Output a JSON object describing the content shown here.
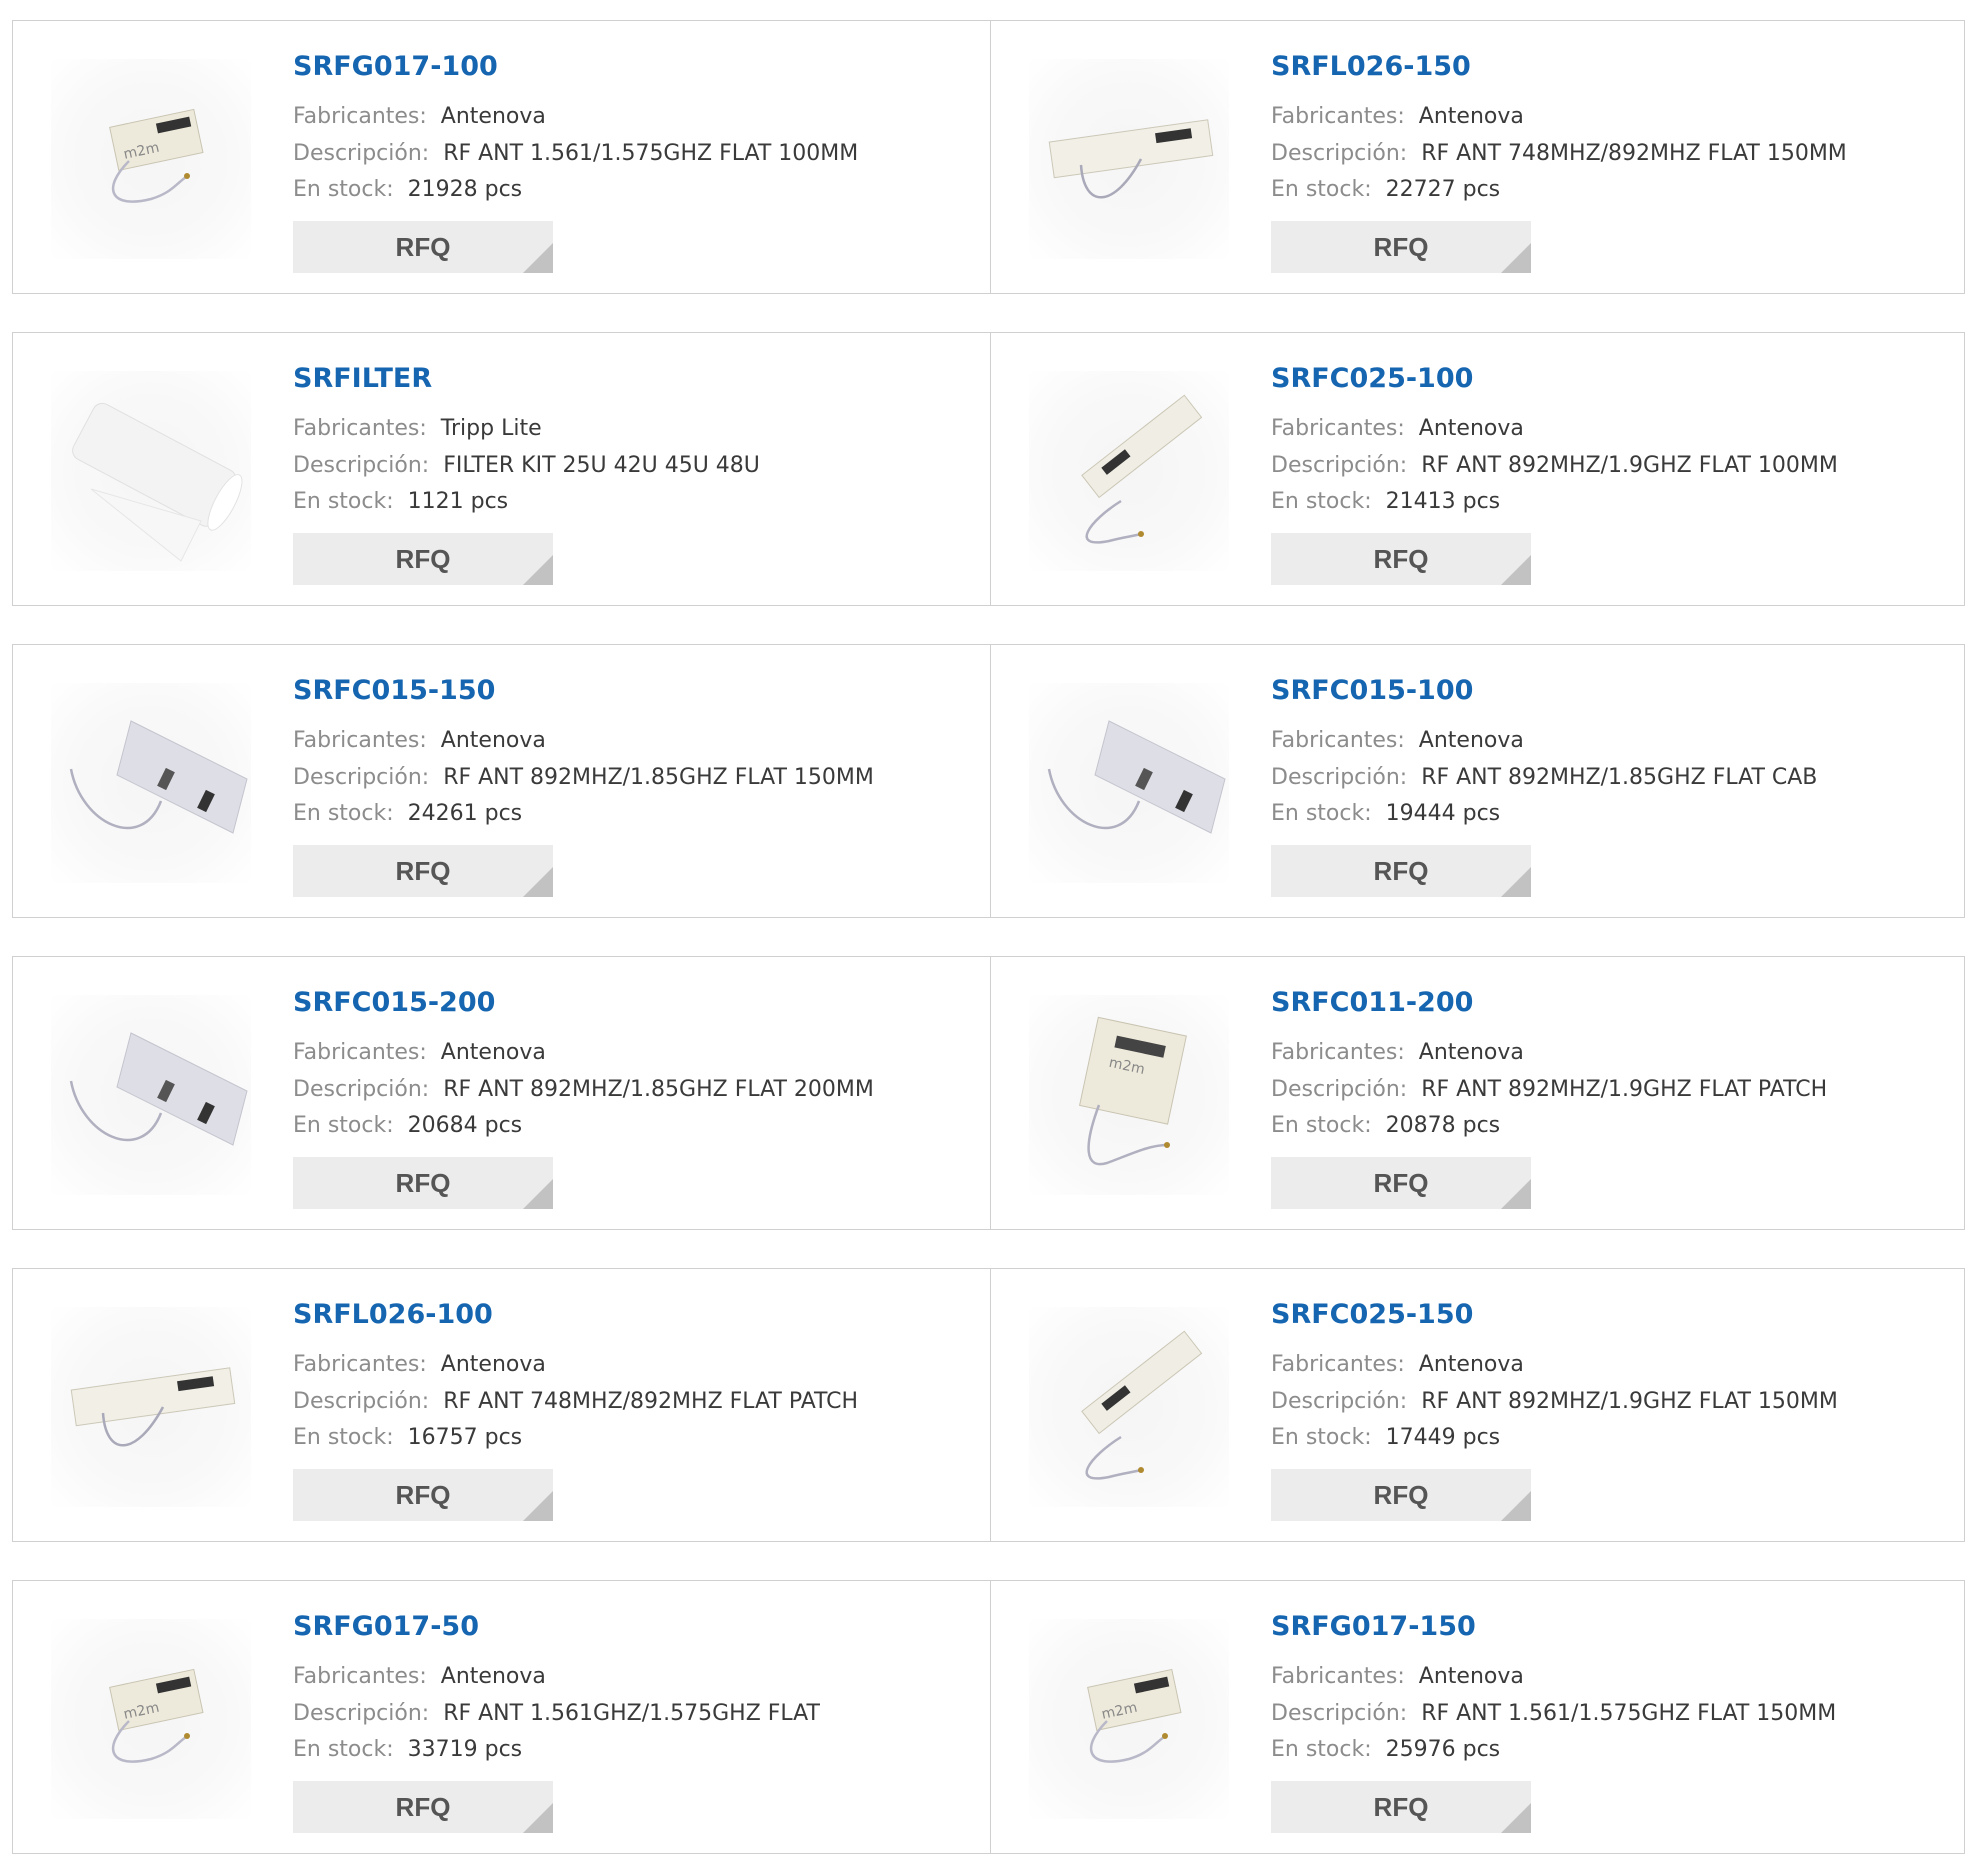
{
  "labels": {
    "manufacturer": "Fabricantes:",
    "description": "Descripción:",
    "stock": "En stock:",
    "rfq": "RFQ"
  },
  "products": [
    {
      "part": "SRFG017-100",
      "manufacturer": "Antenova",
      "description": "RF ANT 1.561/1.575GHZ FLAT 100MM",
      "stock": "21928 pcs",
      "image": "antenna-m2m-small"
    },
    {
      "part": "SRFL026-150",
      "manufacturer": "Antenova",
      "description": "RF ANT 748MHZ/892MHZ FLAT 150MM",
      "stock": "22727 pcs",
      "image": "antenna-long-flat"
    },
    {
      "part": "SRFILTER",
      "manufacturer": "Tripp Lite",
      "description": "FILTER KIT 25U 42U 45U 48U",
      "stock": "1121 pcs",
      "image": "filter-roll"
    },
    {
      "part": "SRFC025-100",
      "manufacturer": "Antenova",
      "description": "RF ANT 892MHZ/1.9GHZ FLAT 100MM",
      "stock": "21413 pcs",
      "image": "antenna-diagonal"
    },
    {
      "part": "SRFC015-150",
      "manufacturer": "Antenova",
      "description": "RF ANT 892MHZ/1.85GHZ FLAT 150MM",
      "stock": "24261 pcs",
      "image": "antenna-slanted-plate"
    },
    {
      "part": "SRFC015-100",
      "manufacturer": "Antenova",
      "description": "RF ANT 892MHZ/1.85GHZ FLAT CAB",
      "stock": "19444 pcs",
      "image": "antenna-slanted-plate"
    },
    {
      "part": "SRFC015-200",
      "manufacturer": "Antenova",
      "description": "RF ANT 892MHZ/1.85GHZ FLAT 200MM",
      "stock": "20684 pcs",
      "image": "antenna-slanted-plate"
    },
    {
      "part": "SRFC011-200",
      "manufacturer": "Antenova",
      "description": "RF ANT 892MHZ/1.9GHZ FLAT PATCH",
      "stock": "20878 pcs",
      "image": "antenna-square-patch"
    },
    {
      "part": "SRFL026-100",
      "manufacturer": "Antenova",
      "description": "RF ANT 748MHZ/892MHZ FLAT PATCH",
      "stock": "16757 pcs",
      "image": "antenna-long-flat"
    },
    {
      "part": "SRFC025-150",
      "manufacturer": "Antenova",
      "description": "RF ANT 892MHZ/1.9GHZ FLAT 150MM",
      "stock": "17449 pcs",
      "image": "antenna-diagonal"
    },
    {
      "part": "SRFG017-50",
      "manufacturer": "Antenova",
      "description": "RF ANT 1.561GHZ/1.575GHZ FLAT",
      "stock": "33719 pcs",
      "image": "antenna-m2m-small"
    },
    {
      "part": "SRFG017-150",
      "manufacturer": "Antenova",
      "description": "RF ANT 1.561/1.575GHZ FLAT 150MM",
      "stock": "25976 pcs",
      "image": "antenna-m2m-small"
    }
  ]
}
